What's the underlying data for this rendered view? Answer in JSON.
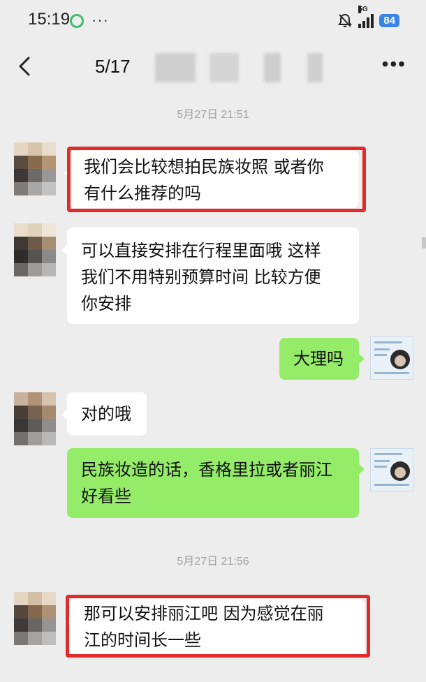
{
  "status_bar": {
    "time": "15:19",
    "network": "5G",
    "battery": "84",
    "icons": [
      "wechat-icon",
      "more-dots-icon",
      "mute-icon",
      "signal-icon",
      "battery-icon"
    ]
  },
  "header": {
    "title": "5/17",
    "back_icon": "chevron-left-icon",
    "more_icon": "more-horizontal-icon"
  },
  "chat": {
    "timestamps": [
      "5月27日 21:51",
      "5月27日 21:56"
    ],
    "messages": [
      {
        "side": "in",
        "lines": [
          "我们会比较想拍民族妆照 或者你",
          "有什么推荐的吗"
        ],
        "highlighted": true
      },
      {
        "side": "in",
        "lines": [
          "可以直接安排在行程里面哦 这样",
          "我们不用特别预算时间 比较方便",
          "你安排"
        ],
        "highlighted": false
      },
      {
        "side": "out",
        "lines": [
          "大理吗"
        ],
        "highlighted": false
      },
      {
        "side": "in",
        "lines": [
          "对的哦"
        ],
        "highlighted": false
      },
      {
        "side": "out",
        "lines": [
          "民族妆造的话，香格里拉或者丽江",
          "好看些"
        ],
        "highlighted": false
      },
      {
        "side": "in",
        "lines": [
          "那可以安排丽江吧 因为感觉在丽",
          "江的时间长一些"
        ],
        "highlighted": true
      }
    ]
  },
  "colors": {
    "background": "#ededed",
    "incoming_bubble": "#ffffff",
    "outgoing_bubble": "#95ec69",
    "highlight_border": "#e02b2b",
    "battery": "#3a84e6"
  }
}
